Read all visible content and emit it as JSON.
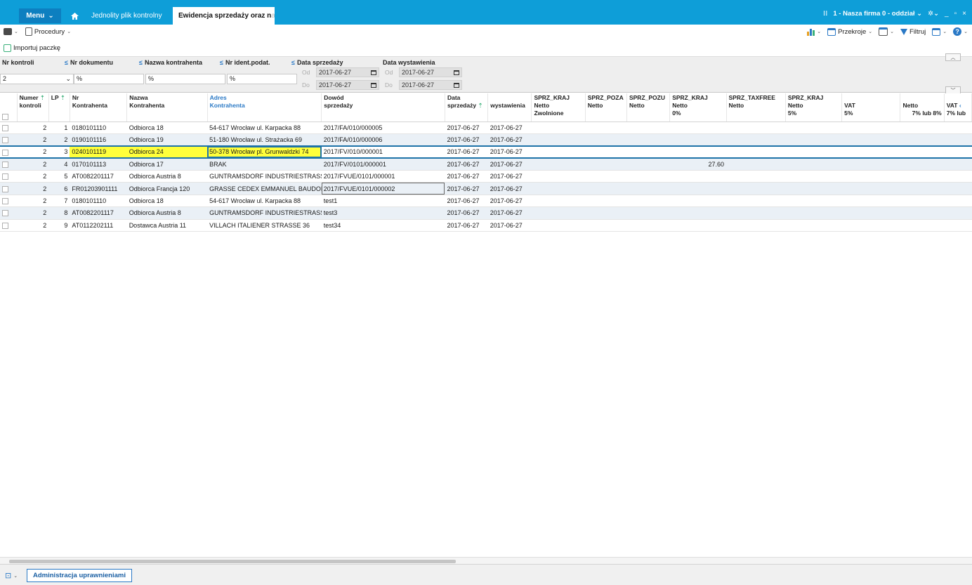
{
  "titlebar": {
    "menu_label": "Menu",
    "tabs": [
      "Jednolity plik kontrolny",
      "Ewidencja sprzedaży oraz n"
    ],
    "tab2_fade": "a",
    "company": "1 - Nasza firma 0 - oddział",
    "window_controls": [
      "_",
      "▫",
      "×"
    ]
  },
  "toolbar": {
    "procedury": "Procedury",
    "przekroje": "Przekroje",
    "filtruj": "Filtruj",
    "importuj": "Importuj paczkę"
  },
  "filters": {
    "labels": [
      "Nr kontroli",
      "Nr dokumentu",
      "Nazwa kontrahenta",
      "Nr ident.podat.",
      "Data sprzedaży",
      "Data wystawienia"
    ],
    "nr_kontroli_value": "2",
    "text_values": [
      "%",
      "%",
      "%"
    ],
    "od": "Od",
    "do": "Do",
    "dates": [
      "2017-06-27",
      "2017-06-27",
      "2017-06-27",
      "2017-06-27"
    ]
  },
  "columns": {
    "numer": [
      "Numer",
      "kontroli"
    ],
    "lp": "LP",
    "nr": [
      "Nr",
      "Kontrahenta"
    ],
    "nazwa": [
      "Nazwa",
      "Kontrahenta"
    ],
    "adres": [
      "Adres",
      "Kontrahenta"
    ],
    "dowod": [
      "Dowód",
      "sprzedaży"
    ],
    "data": [
      "Data",
      "sprzedaży",
      "wystawienia"
    ],
    "sprz": [
      [
        "SPRZ_KRAJ",
        "Netto",
        "Zwolnione"
      ],
      [
        "SPRZ_POZA",
        "Netto",
        ""
      ],
      [
        "SPRZ_POZU",
        "Netto",
        ""
      ],
      [
        "SPRZ_KRAJ",
        "Netto",
        "0%"
      ],
      [
        "SPRZ_TAXFREE",
        "Netto",
        ""
      ],
      [
        "SPRZ_KRAJ",
        "Netto",
        "5%"
      ],
      [
        "",
        "VAT",
        "5%"
      ],
      [
        "",
        "Netto",
        "7% lub 8%"
      ],
      [
        "",
        "VAT",
        "7% lub"
      ]
    ]
  },
  "rows": [
    {
      "numer": "2",
      "lp": "1",
      "nr": "0180101110",
      "nazwa": "Odbiorca 18",
      "adres": "54-617 Wrocław ul. Karpacka 88",
      "dowod": "2017/FA/010/000005",
      "ds": "2017-06-27",
      "dw": "2017-06-27",
      "kraj0": ""
    },
    {
      "numer": "2",
      "lp": "2",
      "nr": "0190101116",
      "nazwa": "Odbiorca 19",
      "adres": "51-180 Wrocław ul. Strażacka 69",
      "dowod": "2017/FA/010/000006",
      "ds": "2017-06-27",
      "dw": "2017-06-27",
      "kraj0": ""
    },
    {
      "numer": "2",
      "lp": "3",
      "nr": "0240101119",
      "nazwa": "Odbiorca 24",
      "adres": "50-378 Wrocław pl. Grunwaldzki 74",
      "dowod": "2017/FV/010/000001",
      "ds": "2017-06-27",
      "dw": "2017-06-27",
      "kraj0": ""
    },
    {
      "numer": "2",
      "lp": "4",
      "nr": "0170101113",
      "nazwa": "Odbiorca 17",
      "adres": "BRAK",
      "dowod": "2017/FV/0101/000001",
      "ds": "2017-06-27",
      "dw": "2017-06-27",
      "kraj0": "27.60"
    },
    {
      "numer": "2",
      "lp": "5",
      "nr": "AT0082201117",
      "nazwa": "Odbiorca Austria 8",
      "adres": "GUNTRAMSDORF INDUSTRIESTRASSE",
      "dowod": "2017/FVUE/0101/000001",
      "ds": "2017-06-27",
      "dw": "2017-06-27",
      "kraj0": ""
    },
    {
      "numer": "2",
      "lp": "6",
      "nr": "FR01203901111",
      "nazwa": "Odbiorca Francja 120",
      "adres": "GRASSE CEDEX EMMANUEL BAUDOIN",
      "dowod": "2017/FVUE/0101/000002",
      "ds": "2017-06-27",
      "dw": "2017-06-27",
      "kraj0": ""
    },
    {
      "numer": "2",
      "lp": "7",
      "nr": "0180101110",
      "nazwa": "Odbiorca 18",
      "adres": "54-617 Wrocław ul. Karpacka 88",
      "dowod": "test1",
      "ds": "2017-06-27",
      "dw": "2017-06-27",
      "kraj0": ""
    },
    {
      "numer": "2",
      "lp": "8",
      "nr": "AT0082201117",
      "nazwa": "Odbiorca Austria 8",
      "adres": "GUNTRAMSDORF INDUSTRIESTRASSE",
      "dowod": "test3",
      "ds": "2017-06-27",
      "dw": "2017-06-27",
      "kraj0": ""
    },
    {
      "numer": "2",
      "lp": "9",
      "nr": "AT0112202111",
      "nazwa": "Dostawca Austria 11",
      "adres": "VILLACH ITALIENER STRASSE 36",
      "dowod": "test34",
      "ds": "2017-06-27",
      "dw": "2017-06-27",
      "kraj0": ""
    }
  ],
  "statusbar": {
    "admin_label": "Administracja uprawnieniami"
  },
  "colors": {
    "titlebar": "#0e9ed8",
    "menu": "#0d7fc0",
    "accent": "#2a79c6",
    "highlight": "#ffff3b",
    "row_alt": "#eaf0f6"
  }
}
